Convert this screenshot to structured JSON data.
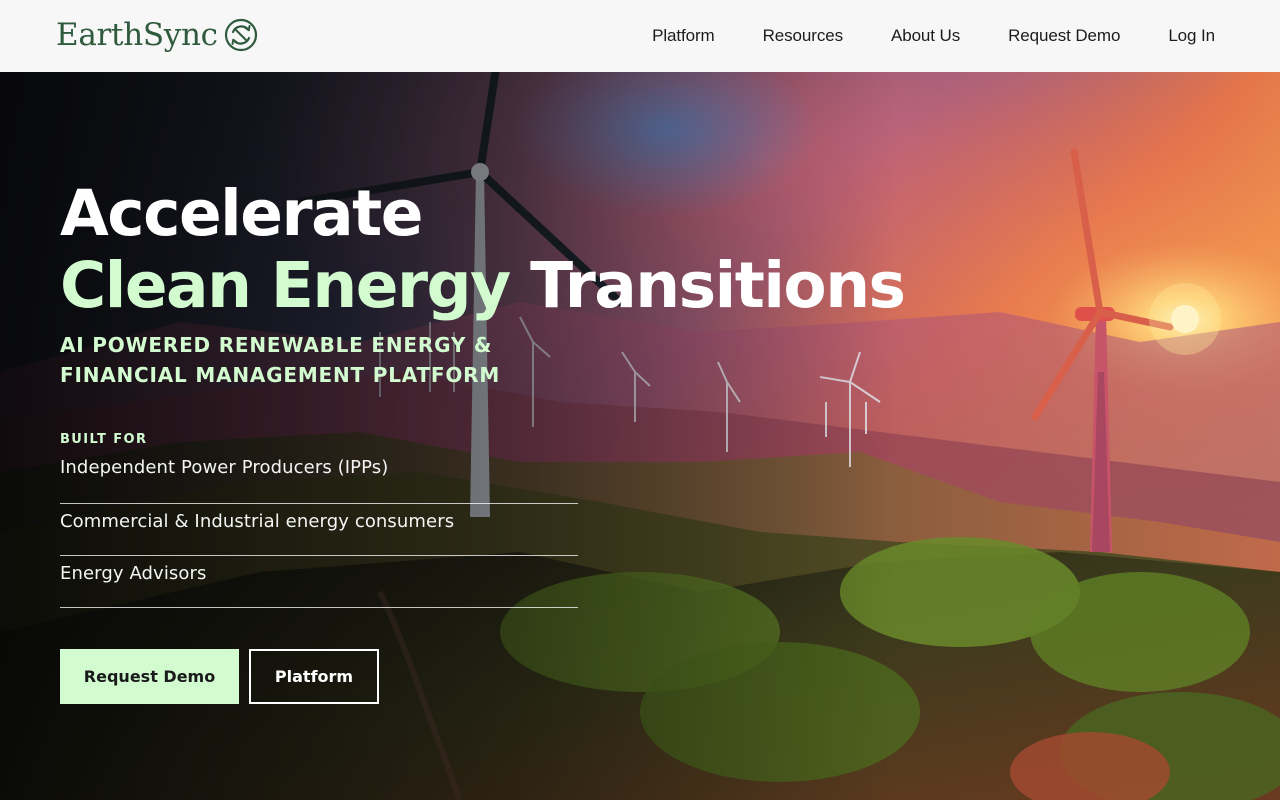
{
  "brand": {
    "name": "EarthSync",
    "color": "#2f5a3e"
  },
  "nav": {
    "items": [
      "Platform",
      "Resources",
      "About Us",
      "Request Demo",
      "Log In"
    ]
  },
  "hero": {
    "headline_line1": "Accelerate",
    "headline_accent": "Clean Energy",
    "headline_rest": " Transitions",
    "subtitle": "AI POWERED RENEWABLE ENERGY & FINANCIAL MANAGEMENT PLATFORM",
    "built_for_label": "BUILT FOR",
    "audience": [
      "Independent Power Producers (IPPs)",
      "Commercial & Industrial energy consumers",
      "Energy Advisors"
    ],
    "primary_cta": "Request Demo",
    "secondary_cta": "Platform"
  },
  "colors": {
    "accent": "#d2fcd0",
    "header_bg": "#f7f7f7"
  },
  "icons": {
    "logo": "sync-circle-icon"
  }
}
